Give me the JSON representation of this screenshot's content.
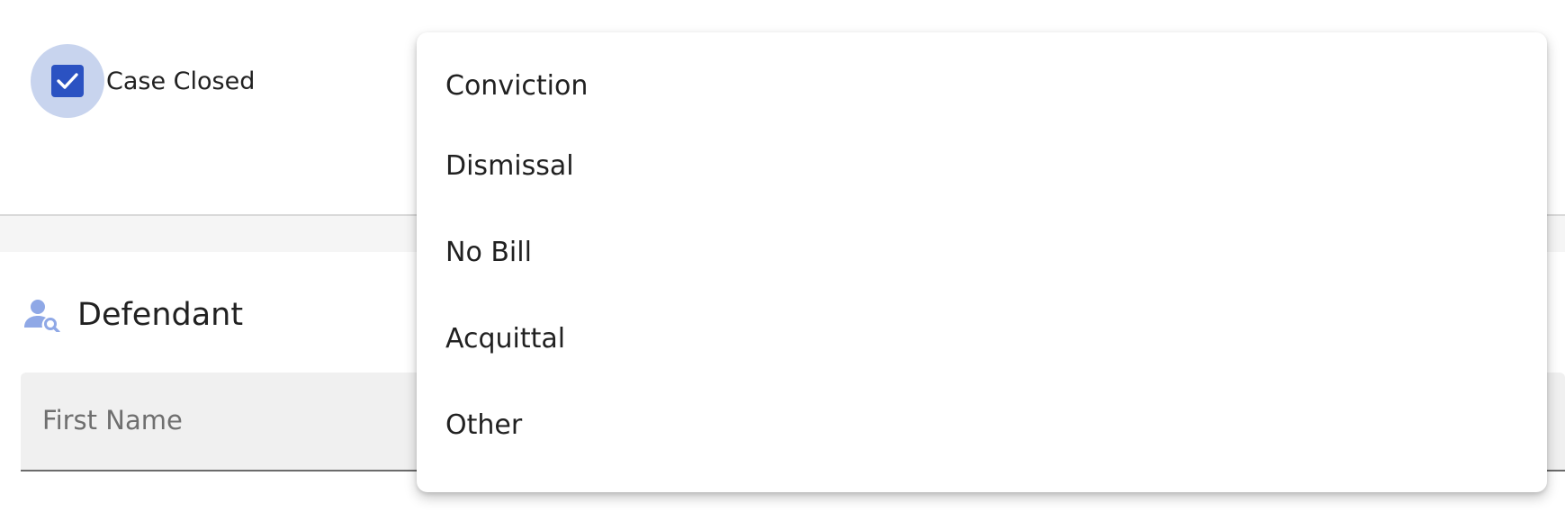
{
  "case_closed": {
    "label": "Case Closed",
    "checked": true,
    "accent_color": "#2b52c2",
    "icon": "check-icon"
  },
  "defendant": {
    "title": "Defendant",
    "icon": "person-search-icon",
    "icon_color": "#8fa8e6",
    "first_name": {
      "label": "First Name",
      "value": ""
    }
  },
  "dropdown": {
    "options": [
      "Conviction",
      "Dismissal",
      "No Bill",
      "Acquittal",
      "Other"
    ]
  }
}
